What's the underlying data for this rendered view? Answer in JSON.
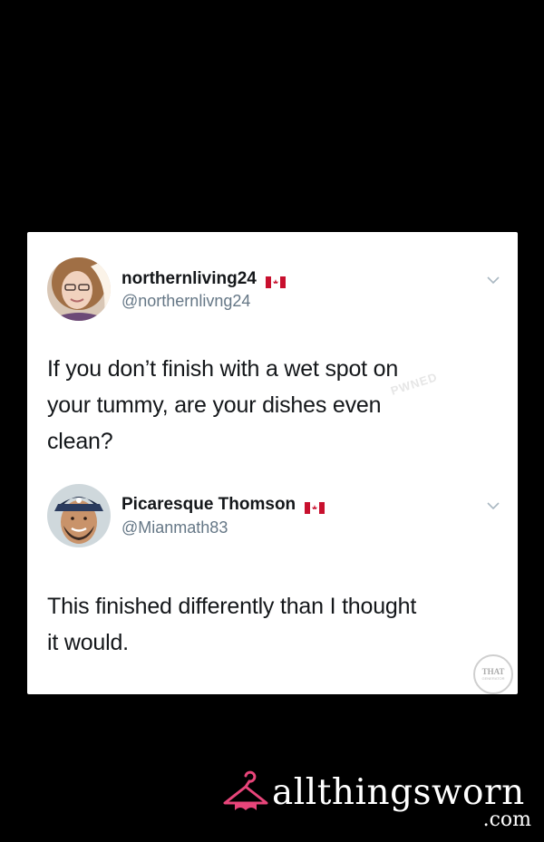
{
  "tweets": [
    {
      "display_name": "northernliving24",
      "handle": "@northernlivng24",
      "text_lines": [
        "If you don’t finish with a wet spot on",
        "your tummy, are your dishes even",
        "clean?"
      ],
      "avatar_icon": "woman-avatar"
    },
    {
      "display_name": "Picaresque Thomson",
      "handle": "@Mianmath83",
      "text_lines": [
        "This finished differently than I thought",
        "it would."
      ],
      "avatar_icon": "man-avatar"
    }
  ],
  "watermarks": {
    "seal_text": "THAT",
    "seal_sub": "GENERATOR",
    "pawned_text": "PWNED"
  },
  "brand": {
    "name": "allthingsworn",
    "tld": ".com",
    "accent": "#e8457a"
  },
  "colors": {
    "background": "#000000",
    "card": "#ffffff",
    "text": "#14171a",
    "muted": "#657786"
  }
}
